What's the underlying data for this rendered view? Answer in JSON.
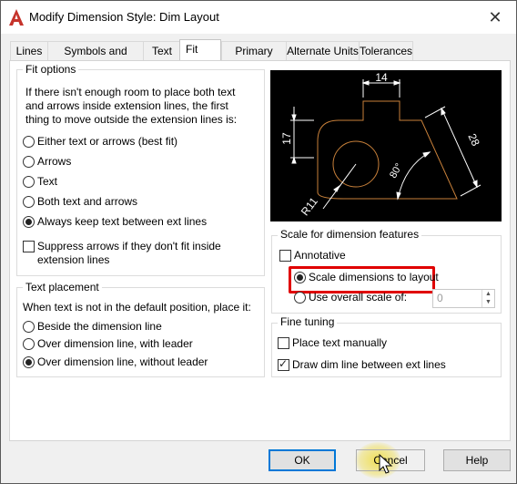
{
  "window": {
    "title": "Modify Dimension Style: Dim Layout",
    "close": "✕"
  },
  "icons": {
    "app": "autocad-a-icon",
    "close": "close-icon"
  },
  "tabs": [
    {
      "label": "Lines"
    },
    {
      "label": "Symbols and Arrows"
    },
    {
      "label": "Text"
    },
    {
      "label": "Fit",
      "active": true
    },
    {
      "label": "Primary Units"
    },
    {
      "label": "Alternate Units"
    },
    {
      "label": "Tolerances"
    }
  ],
  "fit_options": {
    "label": "Fit options",
    "description": "If there isn't enough room to place both text and arrows inside extension lines, the first thing to move outside the extension lines is:",
    "options": [
      {
        "label": "Either text or arrows (best fit)",
        "selected": false
      },
      {
        "label": "Arrows",
        "selected": false
      },
      {
        "label": "Text",
        "selected": false
      },
      {
        "label": "Both text and arrows",
        "selected": false
      },
      {
        "label": "Always keep text between ext lines",
        "selected": true
      }
    ],
    "suppress_arrows": {
      "label_line1": "Suppress arrows if they don't fit inside",
      "label_line2": "extension lines",
      "checked": false
    }
  },
  "text_placement": {
    "label": "Text placement",
    "description": "When text is not in the default position, place it:",
    "options": [
      {
        "label": "Beside the dimension line",
        "selected": false
      },
      {
        "label": "Over dimension line, with leader",
        "selected": false
      },
      {
        "label": "Over dimension line, without leader",
        "selected": true
      }
    ]
  },
  "preview": {
    "dim_top": "14",
    "dim_left": "17",
    "dim_diag": "28",
    "dim_angle": "80°",
    "dim_radius": "R11",
    "colors": {
      "background": "#000000",
      "geometry": "#c8803a",
      "dimension": "#ffffff"
    }
  },
  "scale": {
    "label": "Scale for dimension features",
    "annotative": {
      "label": "Annotative",
      "checked": false
    },
    "scale_to_layout": {
      "label": "Scale dimensions to layout",
      "selected": true
    },
    "overall_scale": {
      "label": "Use overall scale of:",
      "selected": false,
      "value": "0"
    }
  },
  "fine_tuning": {
    "label": "Fine tuning",
    "place_text_manually": {
      "label": "Place text manually",
      "checked": false
    },
    "draw_dim_line": {
      "label": "Draw dim line between ext lines",
      "checked": true
    }
  },
  "buttons": {
    "ok": "OK",
    "cancel": "Cancel",
    "help": "Help"
  },
  "colors": {
    "highlight": "#e00000",
    "focus": "#0078d7"
  }
}
